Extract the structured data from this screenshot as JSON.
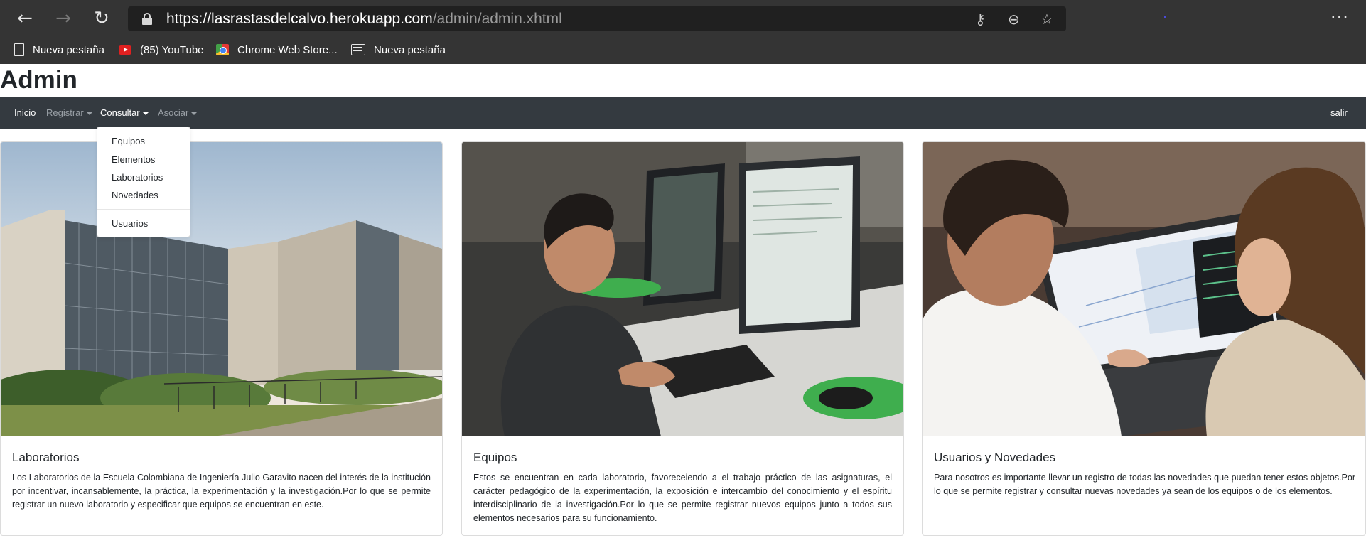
{
  "browser": {
    "url_prefix": "https://",
    "url_host": "lasrastasdelcalvo.herokuapp.com",
    "url_path": "/admin/admin.xhtml",
    "bookmarks": [
      {
        "label": "Nueva pestaña",
        "icon": "page-icon"
      },
      {
        "label": "(85) YouTube",
        "icon": "youtube-icon"
      },
      {
        "label": "Chrome Web Store...",
        "icon": "chrome-web-store-icon"
      },
      {
        "label": "Nueva pestaña",
        "icon": "tab-icon"
      }
    ]
  },
  "page": {
    "title": "Admin"
  },
  "navbar": {
    "items": [
      {
        "label": "Inicio"
      },
      {
        "label": "Registrar"
      },
      {
        "label": "Consultar"
      },
      {
        "label": "Asociar"
      }
    ],
    "logout": "salir"
  },
  "dropdown": {
    "items": [
      "Equipos",
      "Elementos",
      "Laboratorios",
      "Novedades"
    ],
    "after_divider": "Usuarios"
  },
  "cards": [
    {
      "title": "Laboratorios",
      "text": "Los Laboratorios de la Escuela Colombiana de Ingeniería Julio Garavito nacen del interés de la institución por incentivar, incansablemente, la práctica, la experimentación y la investigación.Por lo que se permite registrar un nuevo laboratorio y especificar que equipos se encuentran en este."
    },
    {
      "title": "Equipos",
      "text": "Estos se encuentran en cada laboratorio, favoreceiendo a el trabajo práctico de las asignaturas, el carácter pedagógico de la experimentación, la exposición e intercambio del conocimiento y el espíritu interdisciplinario de la investigación.Por lo que se permite registrar nuevos equipos junto a todos sus elementos necesarios para su funcionamiento."
    },
    {
      "title": "Usuarios y Novedades",
      "text": "Para nosotros es importante llevar un registro de todas las novedades que puedan tener estos objetos.Por lo que se permite registrar y consultar nuevas novedades ya sean de los equipos o de los elementos."
    }
  ],
  "colors": {
    "browser_bg": "#343434",
    "navbar_bg": "#343a40",
    "text": "#212529"
  }
}
